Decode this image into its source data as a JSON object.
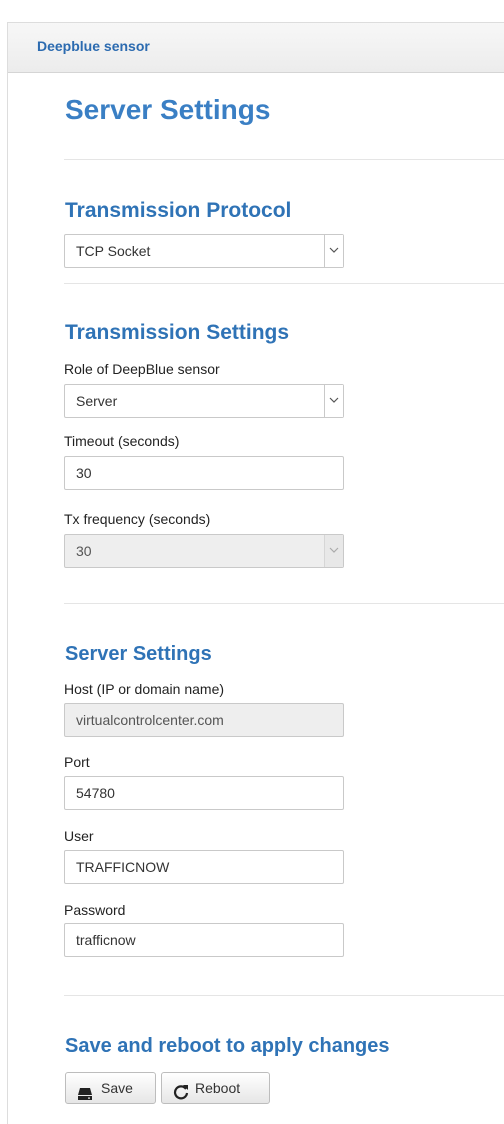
{
  "brand": "Deepblue sensor",
  "page_title": "Server Settings",
  "transmission_protocol": {
    "heading": "Transmission Protocol",
    "selected": "TCP Socket"
  },
  "transmission_settings": {
    "heading": "Transmission Settings",
    "role_label": "Role of DeepBlue sensor",
    "role_value": "Server",
    "timeout_label": "Timeout (seconds)",
    "timeout_value": "30",
    "tx_label": "Tx frequency (seconds)",
    "tx_value": "30"
  },
  "server_settings": {
    "heading": "Server Settings",
    "host_label": "Host (IP or domain name)",
    "host_value": "virtualcontrolcenter.com",
    "port_label": "Port",
    "port_value": "54780",
    "user_label": "User",
    "user_value": "TRAFFICNOW",
    "password_label": "Password",
    "password_value": "trafficnow"
  },
  "apply": {
    "heading": "Save and reboot to apply changes",
    "save_label": "Save",
    "reboot_label": "Reboot",
    "save_icon": "hdd-icon",
    "reboot_icon": "refresh-icon"
  },
  "colors": {
    "heading": "#2f73b6",
    "brand": "#2c6bb0"
  }
}
